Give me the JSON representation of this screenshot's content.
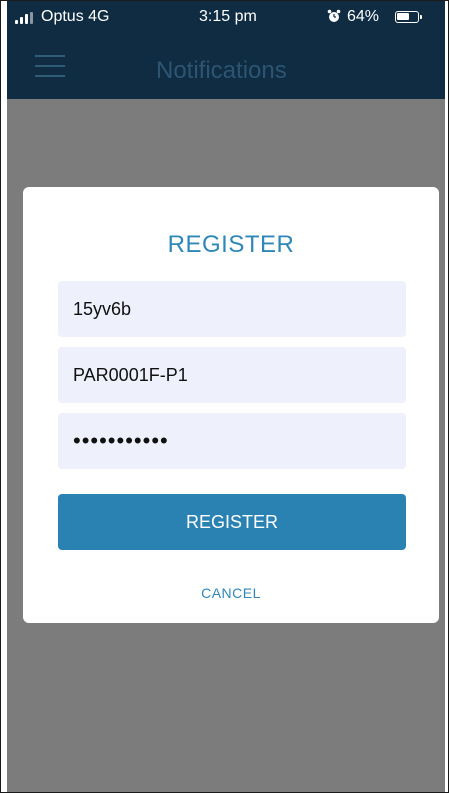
{
  "status_bar": {
    "carrier": "Optus 4G",
    "time": "3:15 pm",
    "battery_percent": "64%",
    "battery_level": 0.64,
    "signal_icon": "signal-bars-icon",
    "alarm_icon": "alarm-clock-icon",
    "battery_icon": "battery-icon"
  },
  "nav": {
    "title": "Notifications",
    "menu_icon": "hamburger-menu-icon"
  },
  "modal": {
    "title": "REGISTER",
    "fields": [
      {
        "value": "15yv6b"
      },
      {
        "value": "PAR0001F-P1"
      },
      {
        "value": "•••••••••••",
        "masked": true
      }
    ],
    "register_label": "REGISTER",
    "cancel_label": "CANCEL"
  },
  "colors": {
    "header_bg": "#0f2c43",
    "accent": "#2a82b3",
    "field_bg": "#eef0fb",
    "backdrop": "#7c7c7c"
  }
}
